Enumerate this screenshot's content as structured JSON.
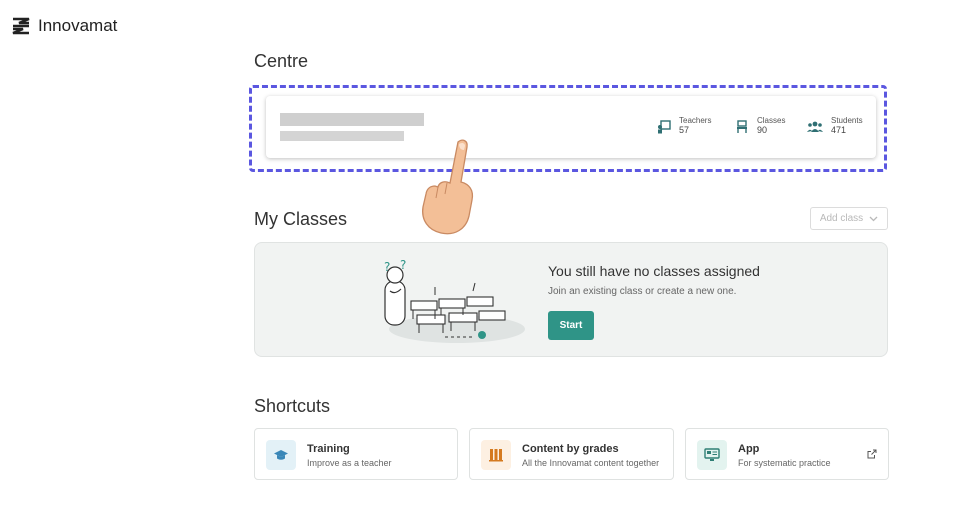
{
  "brand": {
    "name": "Innovamat"
  },
  "centre": {
    "title": "Centre",
    "stats": [
      {
        "label": "Teachers",
        "value": "57",
        "icon": "teacher-icon"
      },
      {
        "label": "Classes",
        "value": "90",
        "icon": "chair-icon"
      },
      {
        "label": "Students",
        "value": "471",
        "icon": "students-icon"
      }
    ]
  },
  "classes": {
    "title": "My Classes",
    "add_class_label": "Add class",
    "empty_title": "You still have no classes assigned",
    "empty_subtitle": "Join an existing class or create a new one.",
    "start_label": "Start"
  },
  "shortcuts": {
    "title": "Shortcuts",
    "items": [
      {
        "title": "Training",
        "subtitle": "Improve as a teacher",
        "icon": "graduation-cap-icon"
      },
      {
        "title": "Content by grades",
        "subtitle": "All the Innovamat content together",
        "icon": "books-icon"
      },
      {
        "title": "App",
        "subtitle": "For systematic practice",
        "icon": "monitor-icon"
      }
    ]
  },
  "colors": {
    "accent": "#2f9487",
    "highlight": "#5b57e0"
  }
}
